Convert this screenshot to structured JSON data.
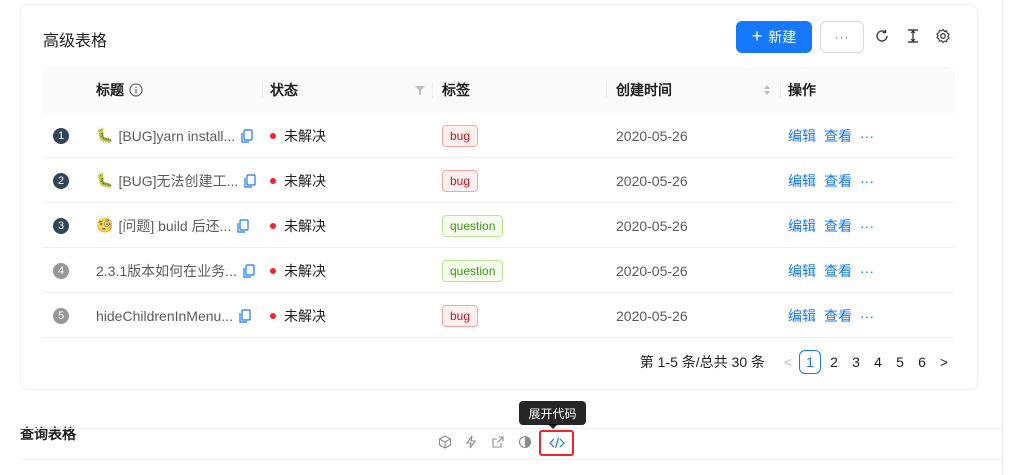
{
  "card": {
    "title": "高级表格",
    "new_button_label": "新建",
    "more_button_label": "···",
    "tools": [
      "reload-icon",
      "column-height-icon",
      "setting-icon"
    ]
  },
  "table": {
    "headers": {
      "title": "标题",
      "status": "状态",
      "tags": "标签",
      "created_at": "创建时间",
      "actions": "操作"
    },
    "rows": [
      {
        "index": "1",
        "emoji": "🐛",
        "title": "[BUG]yarn install...",
        "status": "未解决",
        "tag": "bug",
        "date": "2020-05-26",
        "edit": "编辑",
        "view": "查看",
        "more": "···"
      },
      {
        "index": "2",
        "emoji": "🐛",
        "title": "[BUG]无法创建工...",
        "status": "未解决",
        "tag": "bug",
        "date": "2020-05-26",
        "edit": "编辑",
        "view": "查看",
        "more": "···"
      },
      {
        "index": "3",
        "emoji": "🧐",
        "title": "[问题] build 后还...",
        "status": "未解决",
        "tag": "question",
        "date": "2020-05-26",
        "edit": "编辑",
        "view": "查看",
        "more": "···"
      },
      {
        "index": "4",
        "emoji": "",
        "title": "2.3.1版本如何在业务...",
        "status": "未解决",
        "tag": "question",
        "date": "2020-05-26",
        "edit": "编辑",
        "view": "查看",
        "more": "···"
      },
      {
        "index": "5",
        "emoji": "",
        "title": "hideChildrenInMenu...",
        "status": "未解决",
        "tag": "bug",
        "date": "2020-05-26",
        "edit": "编辑",
        "view": "查看",
        "more": "···"
      }
    ]
  },
  "pagination": {
    "total_text": "第 1-5 条/总共 30 条",
    "pages": [
      "1",
      "2",
      "3",
      "4",
      "5",
      "6"
    ],
    "current": "1",
    "prev": "<",
    "next": ">"
  },
  "section2": {
    "title": "查询表格"
  },
  "code_actions": {
    "tooltip": "展开代码"
  },
  "colors": {
    "primary": "#1677ff",
    "error": "#f5222d",
    "index_dark": "#314659",
    "index_light": "#979797"
  }
}
